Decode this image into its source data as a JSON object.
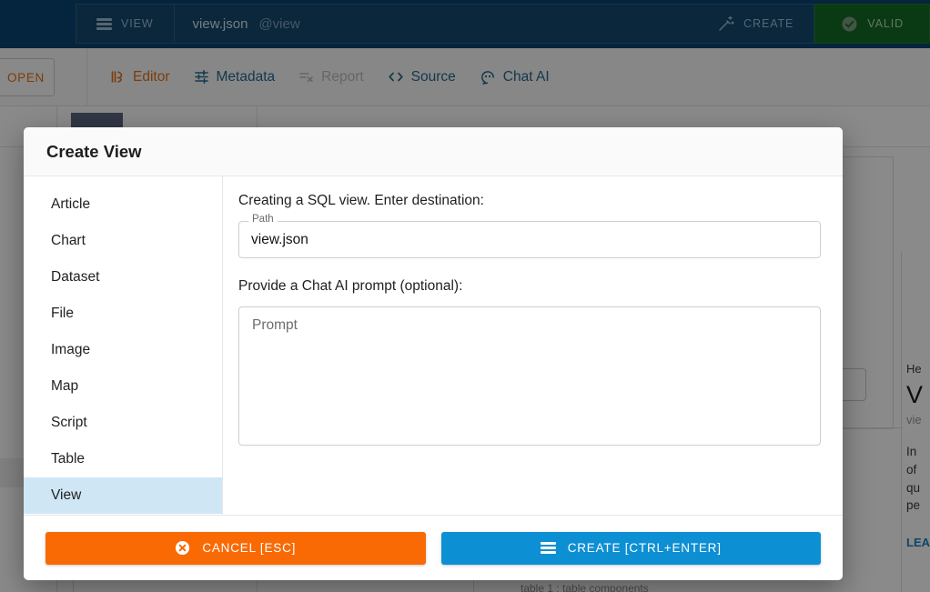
{
  "topbar": {
    "view_button_label": "VIEW",
    "path_filename": "view.json",
    "path_alias": "@view",
    "create_label": "CREATE",
    "valid_label": "VALID",
    "colors": {
      "bar_bg": "#0b4472",
      "button_bg": "#14496f",
      "valid_bg": "#146b23"
    }
  },
  "tabrow": {
    "open_label": "OPEN",
    "tabs": [
      {
        "label": "Editor",
        "state": "active"
      },
      {
        "label": "Metadata",
        "state": "normal"
      },
      {
        "label": "Report",
        "state": "disabled"
      },
      {
        "label": "Source",
        "state": "normal"
      },
      {
        "label": "Chat AI",
        "state": "normal"
      }
    ],
    "colors": {
      "active": "#e8700f",
      "normal": "#26698f",
      "disabled": "#b8bcbf"
    }
  },
  "background": {
    "right_panel": {
      "eyebrow": "He",
      "heading": "V",
      "subheading": "vie",
      "body_lines": [
        "In",
        "of",
        "qu",
        "pe"
      ],
      "link": "LEA"
    },
    "footnote": "table 1 : table components"
  },
  "dialog": {
    "title": "Create View",
    "sidebar": {
      "items": [
        {
          "label": "Article",
          "selected": false
        },
        {
          "label": "Chart",
          "selected": false
        },
        {
          "label": "Dataset",
          "selected": false
        },
        {
          "label": "File",
          "selected": false
        },
        {
          "label": "Image",
          "selected": false
        },
        {
          "label": "Map",
          "selected": false
        },
        {
          "label": "Script",
          "selected": false
        },
        {
          "label": "Table",
          "selected": false
        },
        {
          "label": "View",
          "selected": true
        }
      ],
      "selected_color": "#cfe6f5"
    },
    "main": {
      "destination_label": "Creating a SQL view. Enter destination:",
      "path_legend": "Path",
      "path_value": "view.json",
      "path_placeholder": "Path",
      "prompt_label": "Provide a Chat AI prompt (optional):",
      "prompt_value": "",
      "prompt_placeholder": "Prompt"
    },
    "footer": {
      "cancel_label": "CANCEL [ESC]",
      "create_label": "CREATE [CTRL+ENTER]",
      "cancel_color": "#f96a05",
      "create_color": "#0d8fd4"
    }
  }
}
